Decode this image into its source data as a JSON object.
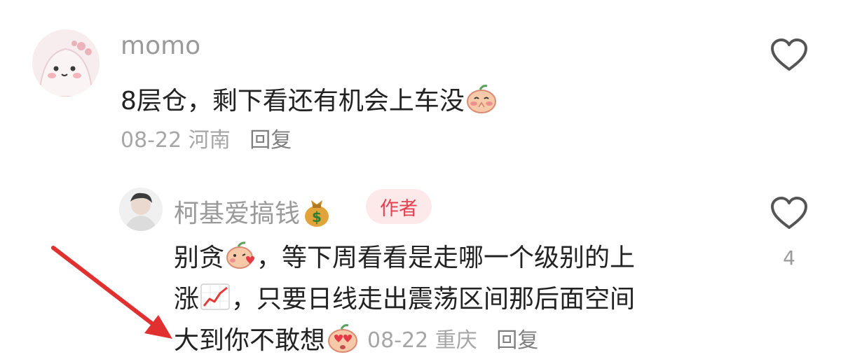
{
  "comments": [
    {
      "username": "momo",
      "text": "8层仓，剩下看还有机会上车没",
      "date": "08-22",
      "location": "河南",
      "reply_label": "回复"
    },
    {
      "username": "柯基爱搞钱",
      "badge": "作者",
      "line1_a": "别贪",
      "line1_b": "，等下周看看是走哪一个级别的上",
      "line2_a": "涨",
      "line2_b": "，只要日线走出震荡区间那后面空间",
      "line3": "大到你不敢想",
      "date": "08-22",
      "location": "重庆",
      "reply_label": "回复",
      "like_count": "4"
    }
  ],
  "icons": {
    "like": "heart-outline-icon",
    "money_bag": "money-bag-icon",
    "chart": "chart-increasing-icon"
  },
  "colors": {
    "annotation_arrow": "#e03030",
    "author_badge_bg": "#fde8ea",
    "author_badge_text": "#e5404f"
  }
}
